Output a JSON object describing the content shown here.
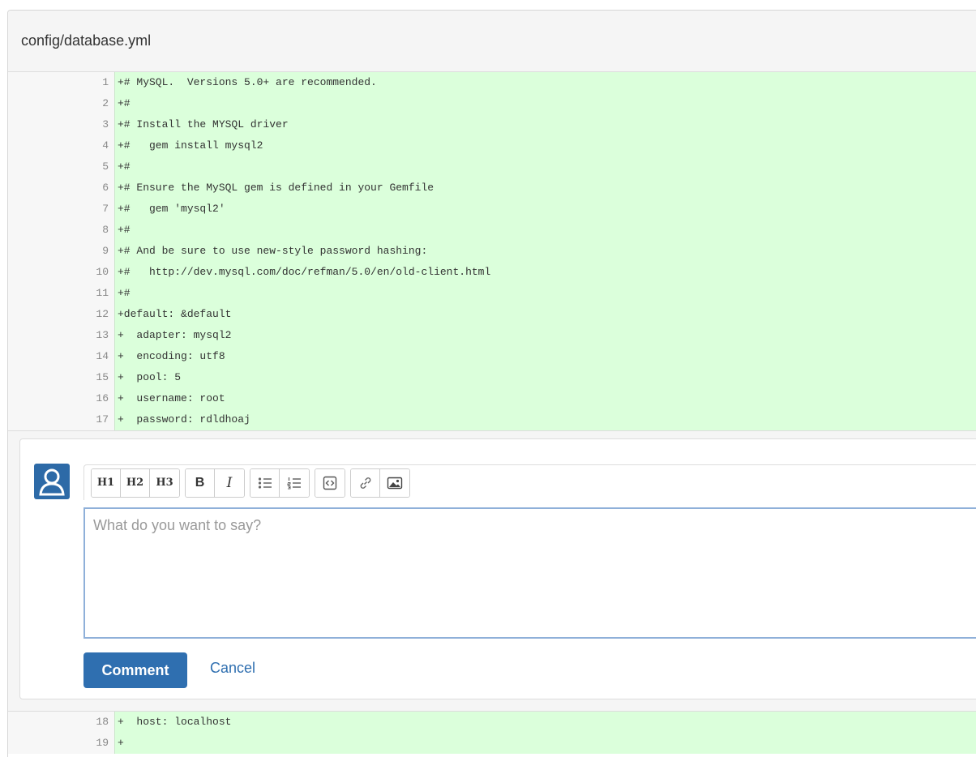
{
  "file": {
    "title": "config/database.yml"
  },
  "diff_lines_top": [
    {
      "num": "1",
      "code": "+# MySQL.  Versions 5.0+ are recommended."
    },
    {
      "num": "2",
      "code": "+#"
    },
    {
      "num": "3",
      "code": "+# Install the MYSQL driver"
    },
    {
      "num": "4",
      "code": "+#   gem install mysql2"
    },
    {
      "num": "5",
      "code": "+#"
    },
    {
      "num": "6",
      "code": "+# Ensure the MySQL gem is defined in your Gemfile"
    },
    {
      "num": "7",
      "code": "+#   gem 'mysql2'"
    },
    {
      "num": "8",
      "code": "+#"
    },
    {
      "num": "9",
      "code": "+# And be sure to use new-style password hashing:"
    },
    {
      "num": "10",
      "code": "+#   http://dev.mysql.com/doc/refman/5.0/en/old-client.html"
    },
    {
      "num": "11",
      "code": "+#"
    },
    {
      "num": "12",
      "code": "+default: &default"
    },
    {
      "num": "13",
      "code": "+  adapter: mysql2"
    },
    {
      "num": "14",
      "code": "+  encoding: utf8"
    },
    {
      "num": "15",
      "code": "+  pool: 5"
    },
    {
      "num": "16",
      "code": "+  username: root"
    },
    {
      "num": "17",
      "code": "+  password: rdldhoaj"
    }
  ],
  "diff_lines_bottom": [
    {
      "num": "18",
      "code": "+  host: localhost"
    },
    {
      "num": "19",
      "code": "+"
    }
  ],
  "comment": {
    "placeholder": "What do you want to say?",
    "submit_label": "Comment",
    "cancel_label": "Cancel",
    "toolbar": {
      "h1": "H1",
      "h2": "H2",
      "h3": "H3",
      "bold": "B",
      "italic": "I"
    }
  },
  "colors": {
    "added_line_bg": "#dbffdb",
    "primary": "#2f6fb0",
    "avatar_bg": "#2d6aa7"
  }
}
